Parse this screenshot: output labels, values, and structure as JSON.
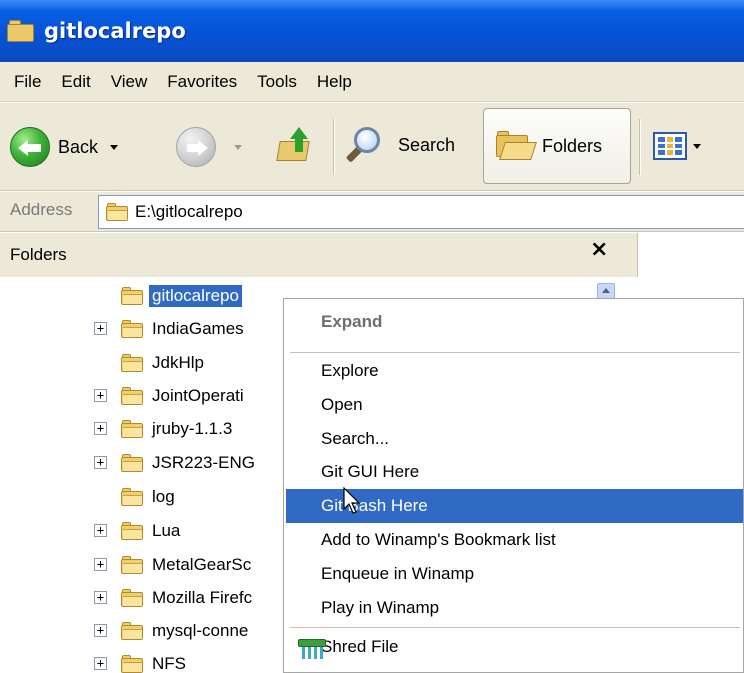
{
  "window": {
    "title": "gitlocalrepo"
  },
  "menu": [
    "File",
    "Edit",
    "View",
    "Favorites",
    "Tools",
    "Help"
  ],
  "toolbar": {
    "back_label": "Back",
    "search_label": "Search",
    "folders_label": "Folders"
  },
  "address": {
    "label": "Address",
    "value": "E:\\gitlocalrepo"
  },
  "folders_pane": {
    "title": "Folders",
    "close": "×",
    "items": [
      {
        "label": "gitlocalrepo",
        "expandable": false,
        "selected": true
      },
      {
        "label": "IndiaGames",
        "expandable": true
      },
      {
        "label": "JdkHlp",
        "expandable": false
      },
      {
        "label": "JointOperati",
        "expandable": true
      },
      {
        "label": "jruby-1.1.3",
        "expandable": true
      },
      {
        "label": "JSR223-ENG",
        "expandable": true
      },
      {
        "label": "log",
        "expandable": false
      },
      {
        "label": "Lua",
        "expandable": true
      },
      {
        "label": "MetalGearSc",
        "expandable": true
      },
      {
        "label": "Mozilla Firefc",
        "expandable": true
      },
      {
        "label": "mysql-conne",
        "expandable": true
      },
      {
        "label": "NFS",
        "expandable": true
      }
    ]
  },
  "context_menu": {
    "items": [
      {
        "label": "Expand",
        "bold": true
      },
      {
        "label": "Explore"
      },
      {
        "label": "Open"
      },
      {
        "label": "Search..."
      },
      {
        "label": "Git GUI Here"
      },
      {
        "label": "Git Bash Here",
        "highlighted": true
      },
      {
        "label": "Add to Winamp's Bookmark list"
      },
      {
        "label": "Enqueue in Winamp"
      },
      {
        "label": "Play in Winamp"
      },
      {
        "label": "Shred File",
        "icon": "shredder-icon"
      }
    ]
  },
  "colors": {
    "titlebar": "#0552d6",
    "selection": "#316ac5",
    "chrome": "#ece9d8"
  }
}
